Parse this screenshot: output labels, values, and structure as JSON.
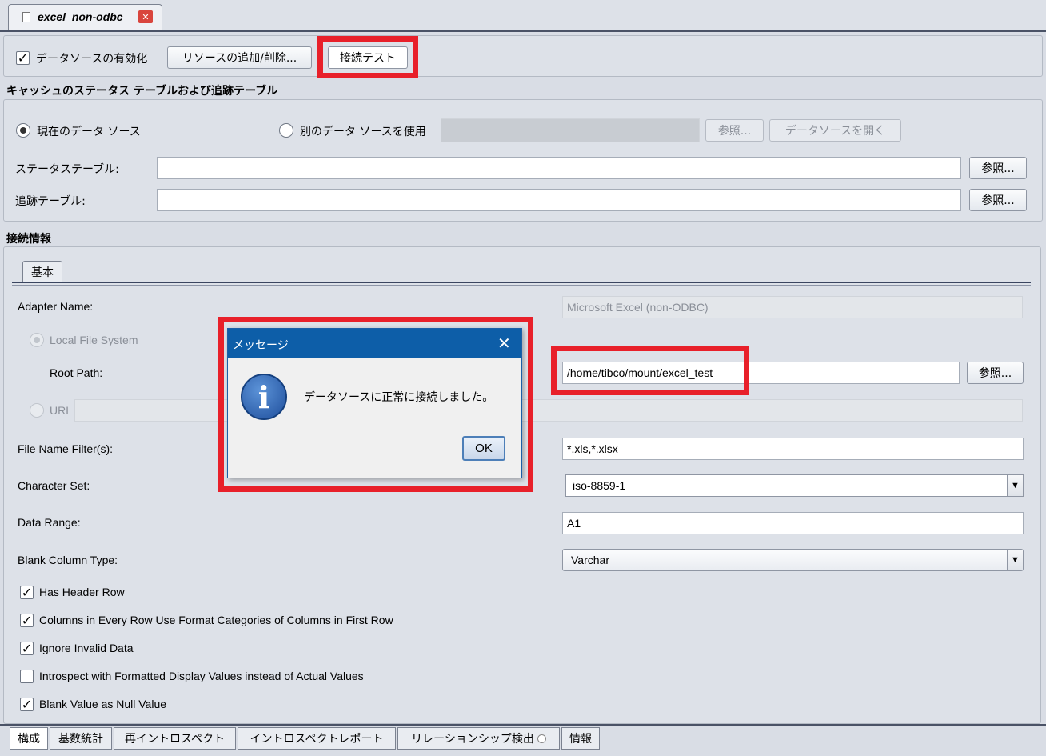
{
  "editor_tab": {
    "title": "excel_non-odbc",
    "close": "✕"
  },
  "toolbar": {
    "enable_label": "データソースの有効化",
    "enable_checked": true,
    "add_remove_label": "リソースの追加/削除...",
    "test_connection_label": "接続テスト"
  },
  "cache": {
    "title": "キャッシュのステータス テーブルおよび追跡テーブル",
    "current_source_label": "現在のデータ ソース",
    "other_source_label": "別のデータ ソースを使用",
    "browse_label": "参照...",
    "open_source_label": "データソースを開く",
    "status_table_label": "ステータステーブル:",
    "status_table_value": "",
    "tracking_table_label": "追跡テーブル:",
    "tracking_table_value": "",
    "status_browse": "参照...",
    "tracking_browse": "参照..."
  },
  "connection": {
    "title": "接続情報",
    "tab_basic": "基本",
    "adapter_name_label": "Adapter Name:",
    "adapter_name_value": "Microsoft Excel (non-ODBC)",
    "local_fs_label": "Local File System",
    "root_path_label": "Root Path:",
    "root_path_value": "/home/tibco/mount/excel_test",
    "root_browse": "参照...",
    "url_label": "URL",
    "file_filter_label": "File Name Filter(s):",
    "file_filter_value": "*.xls,*.xlsx",
    "charset_label": "Character Set:",
    "charset_value": "iso-8859-1",
    "data_range_label": "Data Range:",
    "data_range_value": "A1",
    "blank_col_type_label": "Blank Column Type:",
    "blank_col_type_value": "Varchar",
    "options": [
      {
        "label": "Has Header Row",
        "checked": true
      },
      {
        "label": "Columns in Every Row Use Format Categories of Columns in First Row",
        "checked": true
      },
      {
        "label": "Ignore Invalid Data",
        "checked": true
      },
      {
        "label": "Introspect with Formatted Display Values instead of Actual Values",
        "checked": false
      },
      {
        "label": "Blank Value as Null Value",
        "checked": true
      }
    ]
  },
  "dialog": {
    "title": "メッセージ",
    "message": "データソースに正常に接続しました。",
    "ok_label": "OK",
    "icon": "info-icon"
  },
  "bottom_tabs": [
    "構成",
    "基数統計",
    "再イントロスペクト",
    "イントロスペクトレポート",
    "リレーションシップ検出",
    "情報"
  ],
  "colors": {
    "highlight": "#e8202a",
    "dialog_title_bar": "#0d5ea8",
    "info_icon": "#2a66b8"
  }
}
